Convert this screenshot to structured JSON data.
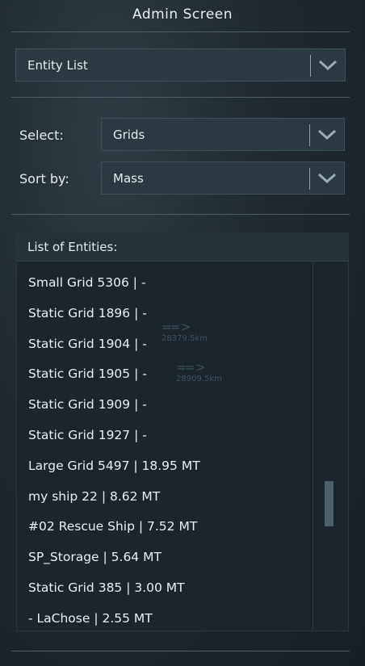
{
  "window": {
    "title": "Admin Screen"
  },
  "mode_dropdown": {
    "value": "Entity List"
  },
  "select": {
    "label": "Select:",
    "value": "Grids"
  },
  "sort": {
    "label": "Sort by:",
    "value": "Mass"
  },
  "entities": {
    "header": "List of Entities:",
    "rows": [
      "Small Grid 5306 | -",
      "Static Grid 1896 | -",
      "Static Grid 1904 | -",
      "Static Grid 1905 | -",
      "Static Grid 1909 | -",
      "Static Grid 1927 | -",
      "Large Grid 5497 | 18.95 MT",
      "my ship 22 | 8.62 MT",
      "#02 Rescue Ship | 7.52 MT",
      "SP_Storage | 5.64 MT",
      "Static Grid 385 | 3.00 MT",
      "- LaChose | 2.55 MT"
    ],
    "scroll_position": 0.62
  },
  "background_markers": [
    {
      "icon": "grid-marker-icon",
      "distance": "28379.5km"
    },
    {
      "icon": "grid-marker-icon",
      "distance": "28909.5km"
    }
  ],
  "colors": {
    "panel": "#2b3941",
    "text": "#e4ecee",
    "divider": "#4c5d64"
  }
}
